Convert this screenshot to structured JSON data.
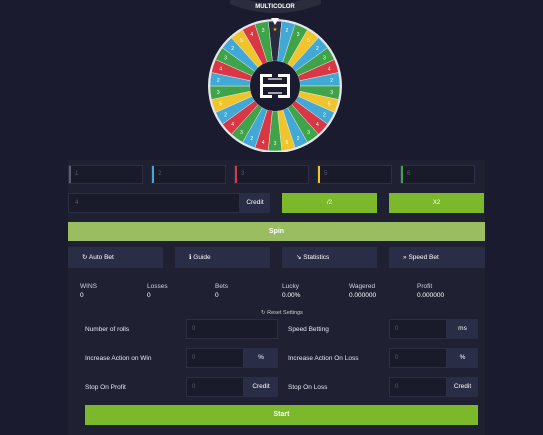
{
  "wheel": {
    "banner_text": "MULTICOLOR",
    "segments": [
      {
        "color": "#2b2d3f",
        "label": "★"
      },
      {
        "color": "#42a9d6",
        "label": "2"
      },
      {
        "color": "#3ea349",
        "label": "3"
      },
      {
        "color": "#f0c52c",
        "label": "5"
      },
      {
        "color": "#42a9d6",
        "label": "2"
      },
      {
        "color": "#3ea349",
        "label": "3"
      },
      {
        "color": "#d93743",
        "label": "4"
      },
      {
        "color": "#42a9d6",
        "label": "2"
      },
      {
        "color": "#3ea349",
        "label": "3"
      },
      {
        "color": "#f0c52c",
        "label": "5"
      },
      {
        "color": "#42a9d6",
        "label": "2"
      },
      {
        "color": "#d93743",
        "label": "4"
      },
      {
        "color": "#3ea349",
        "label": "3"
      },
      {
        "color": "#42a9d6",
        "label": "2"
      },
      {
        "color": "#f0c52c",
        "label": "5"
      },
      {
        "color": "#3ea349",
        "label": "3"
      },
      {
        "color": "#d93743",
        "label": "4"
      },
      {
        "color": "#42a9d6",
        "label": "2"
      },
      {
        "color": "#3ea349",
        "label": "3"
      },
      {
        "color": "#d93743",
        "label": "4"
      },
      {
        "color": "#42a9d6",
        "label": "2"
      },
      {
        "color": "#f0c52c",
        "label": "5"
      },
      {
        "color": "#3ea349",
        "label": "3"
      },
      {
        "color": "#42a9d6",
        "label": "2"
      },
      {
        "color": "#d93743",
        "label": "4"
      },
      {
        "color": "#3ea349",
        "label": "3"
      },
      {
        "color": "#42a9d6",
        "label": "2"
      },
      {
        "color": "#f0c52c",
        "label": "5"
      },
      {
        "color": "#d93743",
        "label": "4"
      },
      {
        "color": "#3ea349",
        "label": "3"
      }
    ]
  },
  "color_bets": [
    {
      "placeholder": "1",
      "color": "#5b5e70"
    },
    {
      "placeholder": "2",
      "color": "#42a9d6"
    },
    {
      "placeholder": "3",
      "color": "#d93743"
    },
    {
      "placeholder": "5",
      "color": "#f0c52c"
    },
    {
      "placeholder": "6",
      "color": "#3ea349"
    }
  ],
  "bet": {
    "amount_placeholder": "4",
    "credit_label": "Credit",
    "half_label": "/2",
    "double_label": "X2",
    "spin_label": "Spin"
  },
  "tabs": {
    "auto_bet": "Auto Bet",
    "guide": "Guide",
    "statistics": "Statistics",
    "speed_bet": "Speed Bet"
  },
  "stats": {
    "wins_label": "WINS",
    "wins": "0",
    "losses_label": "Losses",
    "losses": "0",
    "bets_label": "Bets",
    "bets": "0",
    "lucky_label": "Lucky",
    "lucky": "0.00%",
    "wagered_label": "Wagered",
    "wagered": "0.000000",
    "profit_label": "Profit",
    "profit": "0.000000"
  },
  "auto": {
    "reset_label": "Reset Settings",
    "rolls_label": "Number of rolls",
    "rolls_value": "0",
    "speed_label": "Speed Betting",
    "speed_value": "0",
    "speed_unit": "ms",
    "inc_win_label": "Increase Action on Win",
    "inc_win_value": "0",
    "inc_win_unit": "%",
    "inc_loss_label": "Increase Action On Loss",
    "inc_loss_value": "0",
    "inc_loss_unit": "%",
    "stop_profit_label": "Stop On Profit",
    "stop_profit_value": "0",
    "stop_profit_unit": "Credit",
    "stop_loss_label": "Stop On Loss",
    "stop_loss_value": "0",
    "stop_loss_unit": "Credit",
    "start_label": "Start"
  }
}
